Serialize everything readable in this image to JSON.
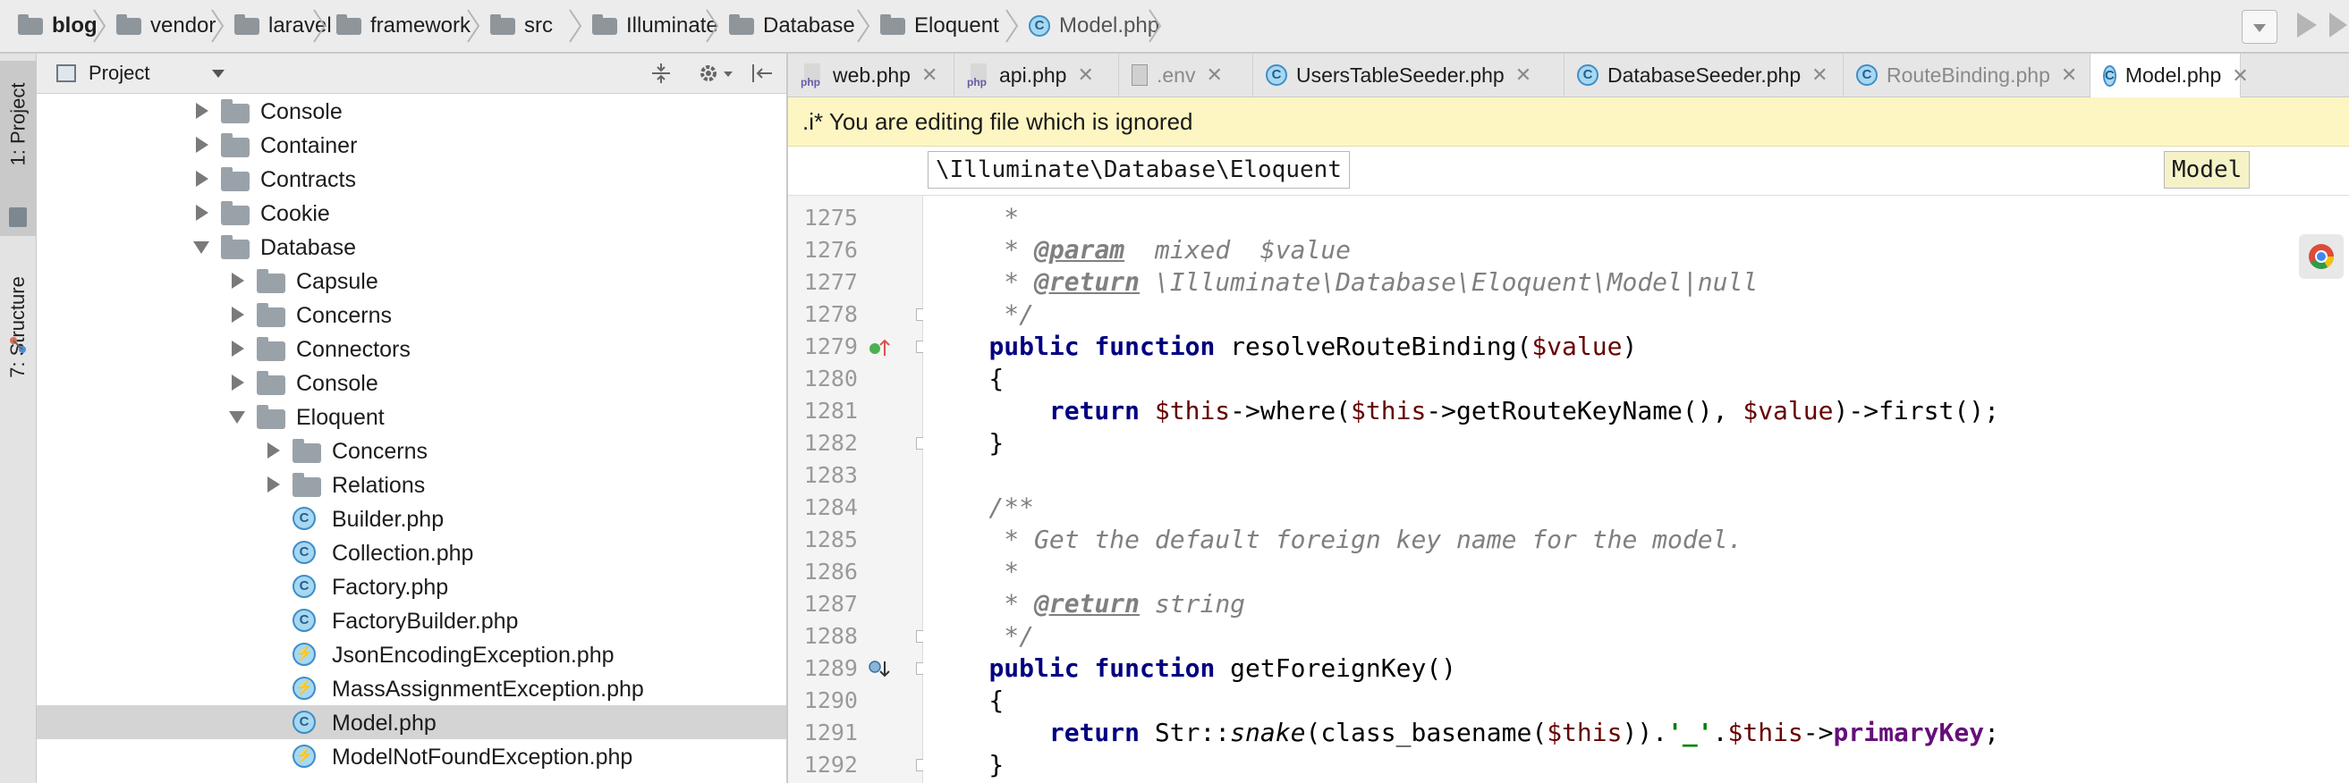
{
  "breadcrumb": [
    {
      "label": "blog",
      "bold": true
    },
    {
      "label": "vendor"
    },
    {
      "label": "laravel"
    },
    {
      "label": "framework"
    },
    {
      "label": "src"
    },
    {
      "label": "Illuminate"
    },
    {
      "label": "Database"
    },
    {
      "label": "Eloquent"
    },
    {
      "label": "Model.php",
      "file": true
    }
  ],
  "project_panel": {
    "title": "Project",
    "tree": [
      {
        "label": "Console",
        "type": "folder",
        "depth": 0,
        "state": "collapsed"
      },
      {
        "label": "Container",
        "type": "folder",
        "depth": 0,
        "state": "collapsed"
      },
      {
        "label": "Contracts",
        "type": "folder",
        "depth": 0,
        "state": "collapsed"
      },
      {
        "label": "Cookie",
        "type": "folder",
        "depth": 0,
        "state": "collapsed"
      },
      {
        "label": "Database",
        "type": "folder",
        "depth": 0,
        "state": "expanded"
      },
      {
        "label": "Capsule",
        "type": "folder",
        "depth": 1,
        "state": "collapsed"
      },
      {
        "label": "Concerns",
        "type": "folder",
        "depth": 1,
        "state": "collapsed"
      },
      {
        "label": "Connectors",
        "type": "folder",
        "depth": 1,
        "state": "collapsed"
      },
      {
        "label": "Console",
        "type": "folder",
        "depth": 1,
        "state": "collapsed"
      },
      {
        "label": "Eloquent",
        "type": "folder",
        "depth": 1,
        "state": "expanded"
      },
      {
        "label": "Concerns",
        "type": "folder",
        "depth": 2,
        "state": "collapsed"
      },
      {
        "label": "Relations",
        "type": "folder",
        "depth": 2,
        "state": "collapsed"
      },
      {
        "label": "Builder.php",
        "type": "class",
        "depth": 2
      },
      {
        "label": "Collection.php",
        "type": "class",
        "depth": 2
      },
      {
        "label": "Factory.php",
        "type": "class",
        "depth": 2
      },
      {
        "label": "FactoryBuilder.php",
        "type": "class",
        "depth": 2
      },
      {
        "label": "JsonEncodingException.php",
        "type": "exception",
        "depth": 2
      },
      {
        "label": "MassAssignmentException.php",
        "type": "exception",
        "depth": 2
      },
      {
        "label": "Model.php",
        "type": "class",
        "depth": 2,
        "selected": true
      },
      {
        "label": "ModelNotFoundException.php",
        "type": "exception",
        "depth": 2
      }
    ]
  },
  "side_tabs": {
    "project": "1: Project",
    "structure": "7: Structure"
  },
  "tabs": [
    {
      "label": "web.php",
      "icon": "php"
    },
    {
      "label": "api.php",
      "icon": "php"
    },
    {
      "label": ".env",
      "icon": "env",
      "muted": true
    },
    {
      "label": "UsersTableSeeder.php",
      "icon": "class"
    },
    {
      "label": "DatabaseSeeder.php",
      "icon": "class"
    },
    {
      "label": "RouteBinding.php",
      "icon": "class",
      "muted": true
    },
    {
      "label": "Model.php",
      "icon": "class",
      "active": true
    }
  ],
  "banner": ".i* You are editing file which is ignored",
  "code_breadcrumb": [
    "\\Illuminate\\Database\\Eloquent",
    "Model"
  ],
  "code": {
    "lines": [
      {
        "num": "1275",
        "tokens": [
          {
            "t": "     *",
            "c": "doc"
          }
        ]
      },
      {
        "num": "1276",
        "tokens": [
          {
            "t": "     * ",
            "c": "doc"
          },
          {
            "t": "@param",
            "c": "doctag"
          },
          {
            "t": "  mixed  $value",
            "c": "doc"
          }
        ]
      },
      {
        "num": "1277",
        "tokens": [
          {
            "t": "     * ",
            "c": "doc"
          },
          {
            "t": "@return",
            "c": "doctag"
          },
          {
            "t": " \\Illuminate\\Database\\Eloquent\\Model|null",
            "c": "doc"
          }
        ]
      },
      {
        "num": "1278",
        "tokens": [
          {
            "t": "     */",
            "c": "doc"
          }
        ]
      },
      {
        "num": "1279",
        "tokens": [
          {
            "t": "    "
          },
          {
            "t": "public function",
            "c": "kw"
          },
          {
            "t": " resolveRouteBinding("
          },
          {
            "t": "$value",
            "c": "var"
          },
          {
            "t": ")"
          }
        ]
      },
      {
        "num": "1280",
        "tokens": [
          {
            "t": "    {"
          }
        ]
      },
      {
        "num": "1281",
        "tokens": [
          {
            "t": "        "
          },
          {
            "t": "return",
            "c": "kw"
          },
          {
            "t": " "
          },
          {
            "t": "$this",
            "c": "var"
          },
          {
            "t": "->where("
          },
          {
            "t": "$this",
            "c": "var"
          },
          {
            "t": "->getRouteKeyName(), "
          },
          {
            "t": "$value",
            "c": "var"
          },
          {
            "t": ")->first();"
          }
        ]
      },
      {
        "num": "1282",
        "tokens": [
          {
            "t": "    }"
          }
        ]
      },
      {
        "num": "1283",
        "tokens": [
          {
            "t": ""
          }
        ]
      },
      {
        "num": "1284",
        "tokens": [
          {
            "t": "    /**",
            "c": "doc"
          }
        ]
      },
      {
        "num": "1285",
        "tokens": [
          {
            "t": "     * Get the default foreign key name for the model.",
            "c": "doc"
          }
        ]
      },
      {
        "num": "1286",
        "tokens": [
          {
            "t": "     *",
            "c": "doc"
          }
        ]
      },
      {
        "num": "1287",
        "tokens": [
          {
            "t": "     * ",
            "c": "doc"
          },
          {
            "t": "@return",
            "c": "doctag"
          },
          {
            "t": " string",
            "c": "doc"
          }
        ]
      },
      {
        "num": "1288",
        "tokens": [
          {
            "t": "     */",
            "c": "doc"
          }
        ]
      },
      {
        "num": "1289",
        "tokens": [
          {
            "t": "    "
          },
          {
            "t": "public function",
            "c": "kw"
          },
          {
            "t": " getForeignKey()"
          }
        ]
      },
      {
        "num": "1290",
        "tokens": [
          {
            "t": "    {"
          }
        ]
      },
      {
        "num": "1291",
        "tokens": [
          {
            "t": "        "
          },
          {
            "t": "return",
            "c": "kw"
          },
          {
            "t": " Str::"
          },
          {
            "t": "snake",
            "c": "ital"
          },
          {
            "t": "(class_basename("
          },
          {
            "t": "$this",
            "c": "var"
          },
          {
            "t": "))."
          },
          {
            "t": "'_'",
            "c": "str"
          },
          {
            "t": "."
          },
          {
            "t": "$this",
            "c": "var"
          },
          {
            "t": "->"
          },
          {
            "t": "primaryKey",
            "c": "fld"
          },
          {
            "t": ";"
          }
        ]
      },
      {
        "num": "1292",
        "tokens": [
          {
            "t": "    }"
          }
        ]
      }
    ]
  },
  "colors": {
    "banner_bg": "#fdf6c3",
    "keyword": "#000080",
    "variable": "#660000",
    "comment": "#808080"
  }
}
